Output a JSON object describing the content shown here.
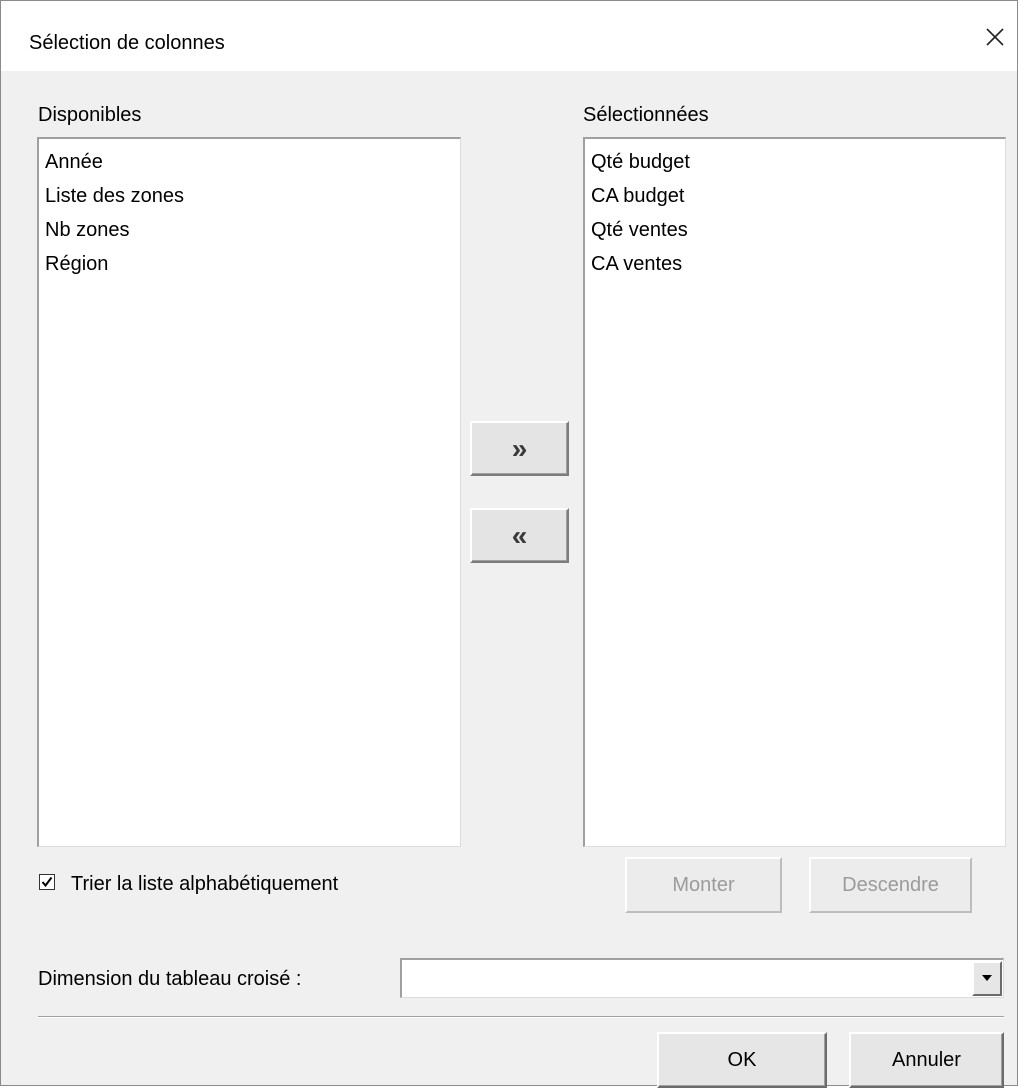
{
  "dialog": {
    "title": "Sélection de colonnes"
  },
  "available": {
    "label": "Disponibles",
    "items": [
      "Année",
      "Liste des zones",
      "Nb zones",
      "Région"
    ]
  },
  "selected": {
    "label": "Sélectionnées",
    "items": [
      "Qté budget",
      "CA budget",
      "Qté ventes",
      "CA ventes"
    ]
  },
  "transfer": {
    "add_label": "»",
    "remove_label": "«"
  },
  "sort": {
    "label": "Trier la liste alphabétiquement",
    "checked": true
  },
  "order_buttons": {
    "up_label": "Monter",
    "down_label": "Descendre",
    "enabled": false
  },
  "dimension": {
    "label": "Dimension du tableau croisé :",
    "value": ""
  },
  "actions": {
    "ok_label": "OK",
    "cancel_label": "Annuler"
  },
  "icons": {
    "close": "close-icon",
    "check": "checkmark-icon",
    "dropdown": "chevron-down-icon"
  }
}
